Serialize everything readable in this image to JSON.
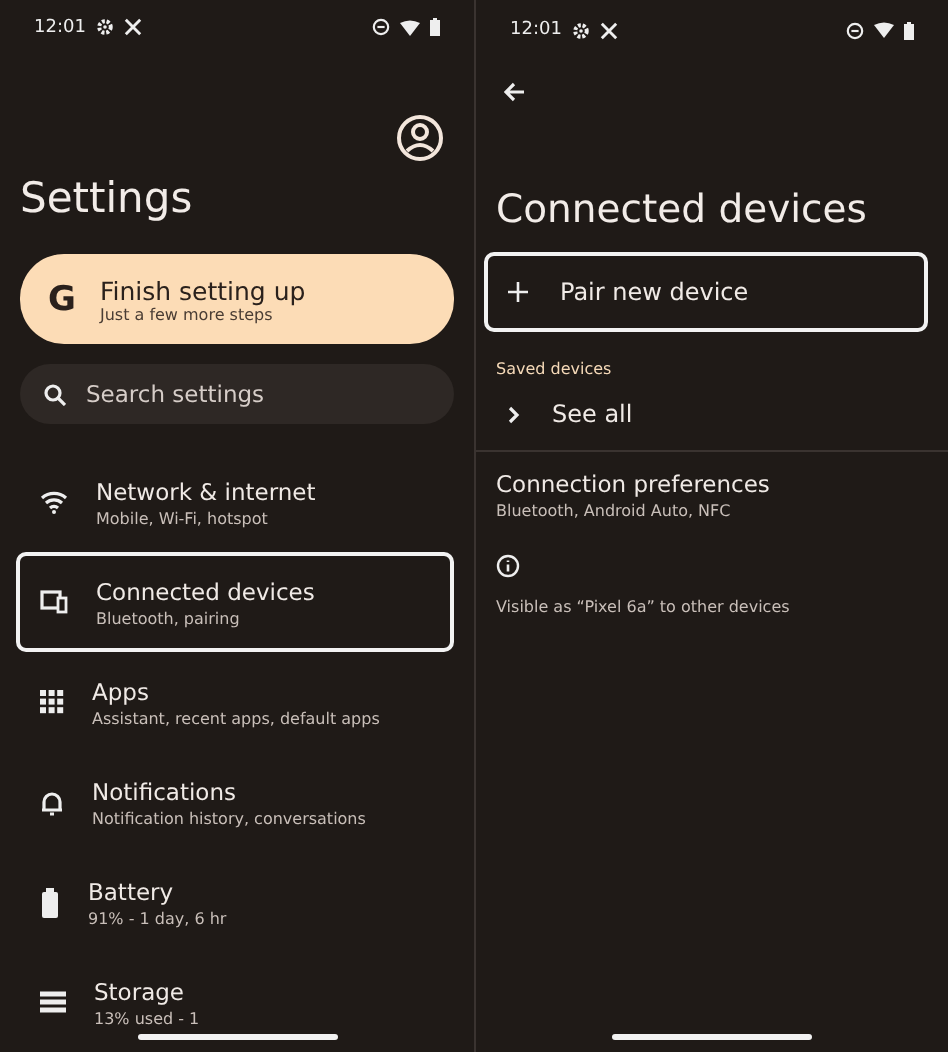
{
  "left_screen": {
    "status_bar": {
      "time": "12:01"
    },
    "title": "Settings",
    "setup_card": {
      "logo": "G",
      "title": "Finish setting up",
      "subtitle": "Just a few more steps"
    },
    "search": {
      "placeholder": "Search settings"
    },
    "items": [
      {
        "kind": "wifi",
        "title": "Network & internet",
        "subtitle": "Mobile, Wi-Fi, hotspot",
        "highlighted": false
      },
      {
        "kind": "devices",
        "title": "Connected devices",
        "subtitle": "Bluetooth, pairing",
        "highlighted": true
      },
      {
        "kind": "apps",
        "title": "Apps",
        "subtitle": "Assistant, recent apps, default apps",
        "highlighted": false
      },
      {
        "kind": "bell",
        "title": "Notifications",
        "subtitle": "Notification history, conversations",
        "highlighted": false
      },
      {
        "kind": "battery",
        "title": "Battery",
        "subtitle": "91% - 1 day, 6 hr",
        "highlighted": false
      },
      {
        "kind": "storage",
        "title": "Storage",
        "subtitle": "13% used - 1",
        "highlighted": false
      }
    ]
  },
  "right_screen": {
    "status_bar": {
      "time": "12:01"
    },
    "title": "Connected devices",
    "pair_button": {
      "label": "Pair new device",
      "highlighted": true
    },
    "section_label": "Saved devices",
    "see_all": "See all",
    "preferences": {
      "title": "Connection preferences",
      "subtitle": "Bluetooth, Android Auto, NFC"
    },
    "visibility_note": "Visible as “Pixel 6a” to other devices"
  }
}
